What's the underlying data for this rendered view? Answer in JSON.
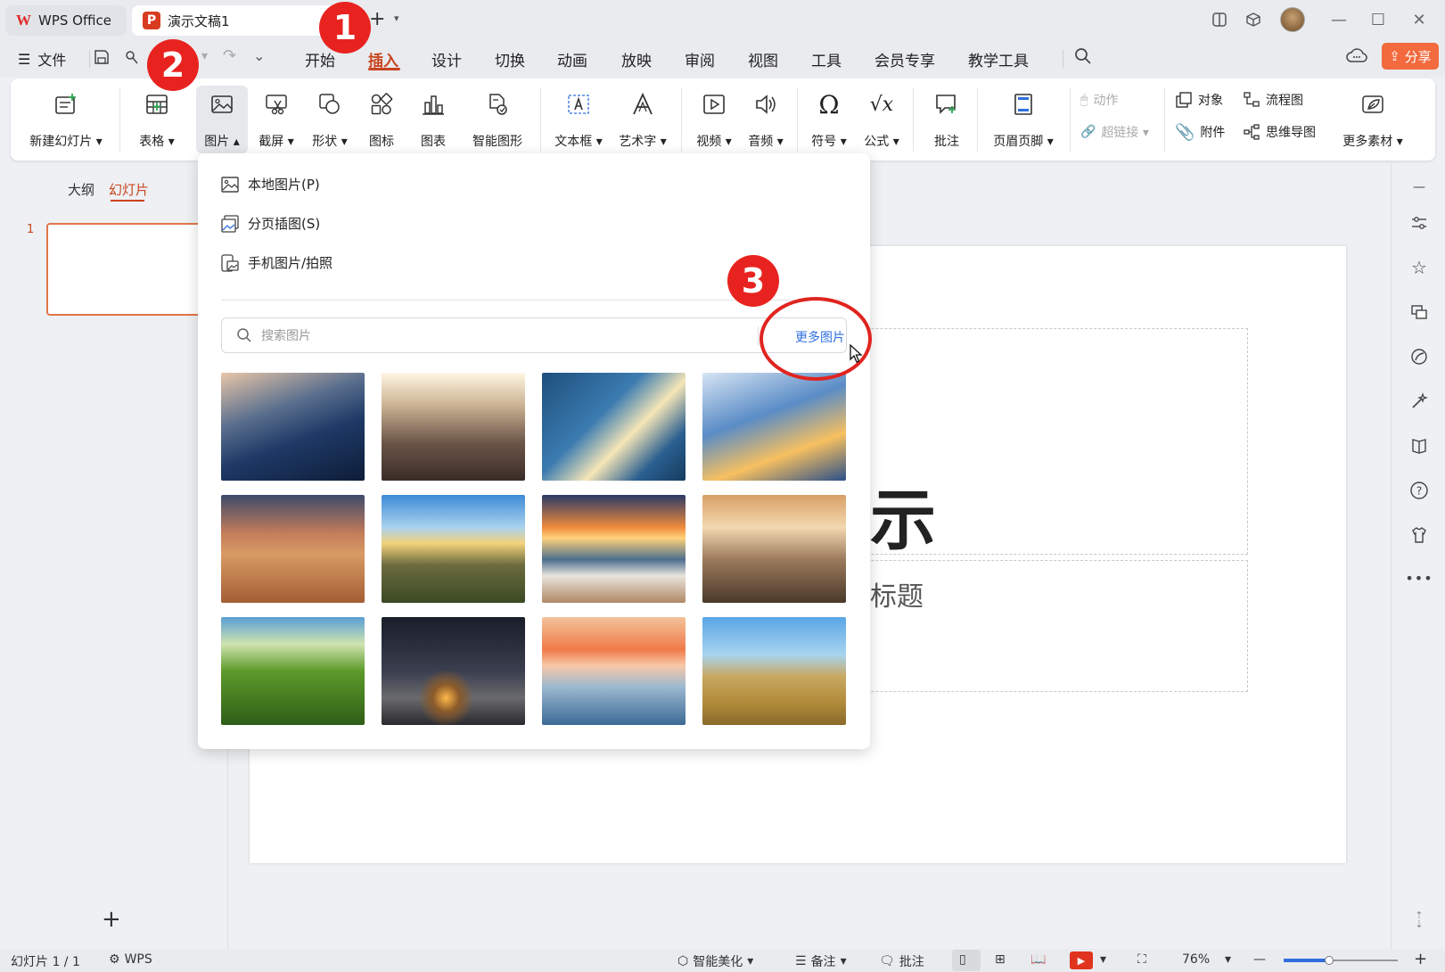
{
  "titlebar": {
    "app_tab_label": "WPS Office",
    "doc_tab_label": "演示文稿1",
    "new_tab_symbol": "+",
    "share_label": "分享"
  },
  "menubar": {
    "file_label": "文件",
    "tabs": [
      "开始",
      "插入",
      "设计",
      "切换",
      "动画",
      "放映",
      "审阅",
      "视图",
      "工具",
      "会员专享",
      "教学工具"
    ],
    "active_tab": "插入"
  },
  "ribbon": {
    "new_slide": "新建幻灯片",
    "table": "表格",
    "picture": "图片",
    "screenshot": "截屏",
    "shape": "形状",
    "icon": "图标",
    "chart": "图表",
    "smart_art": "智能图形",
    "textbox": "文本框",
    "word_art": "艺术字",
    "video": "视频",
    "audio": "音频",
    "symbol": "符号",
    "formula": "公式",
    "comment": "批注",
    "header_footer": "页眉页脚",
    "action": "动作",
    "hyperlink": "超链接",
    "object": "对象",
    "attachment": "附件",
    "flowchart": "流程图",
    "mindmap": "思维导图",
    "more_material": "更多素材"
  },
  "leftpanel": {
    "tab_outline": "大纲",
    "tab_slides": "幻灯片",
    "slide_number": "1",
    "add_symbol": "+"
  },
  "slide": {
    "title_fragment": "示",
    "subtitle_fragment": "标题"
  },
  "dropdown": {
    "local_picture": "本地图片(P)",
    "paged_picture": "分页插图(S)",
    "phone_picture": "手机图片/拍照",
    "search_placeholder": "搜索图片",
    "more_pictures": "更多图片",
    "thumbnails": [
      "curved-building",
      "skyscrapers-up",
      "glass-facade",
      "tower-sunlight",
      "desert-dunes",
      "great-wall",
      "sea-sunset",
      "rocky-coast",
      "green-field-car",
      "night-tent",
      "lake-sunset",
      "horses-grassland"
    ]
  },
  "markers": [
    "1",
    "2",
    "3"
  ],
  "statusbar": {
    "slide_info": "幻灯片 1 / 1",
    "wps_label": "WPS",
    "smart_beautify": "智能美化",
    "notes": "备注",
    "comments": "批注",
    "zoom": "76%",
    "minus": "—",
    "plus": "+"
  },
  "colors": {
    "accent": "#c9441f",
    "marker_red": "#e8231f",
    "link_blue": "#2f6fde",
    "share_orange": "#f26a3d"
  }
}
